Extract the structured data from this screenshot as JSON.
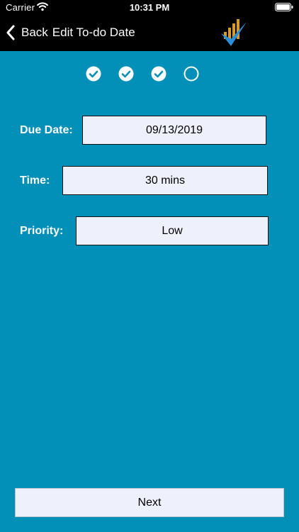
{
  "status_bar": {
    "carrier": "Carrier",
    "time": "10:31 PM"
  },
  "nav": {
    "back_label": "Back",
    "title": "Edit To-do Date",
    "logo_icon": "checkmark-bar-chart-logo"
  },
  "steps": [
    {
      "completed": true
    },
    {
      "completed": true
    },
    {
      "completed": true
    },
    {
      "completed": false
    }
  ],
  "form": {
    "due_date": {
      "label": "Due Date:",
      "value": "09/13/2019"
    },
    "time": {
      "label": "Time:",
      "value": "30 mins"
    },
    "priority": {
      "label": "Priority:",
      "value": "Low"
    }
  },
  "next_button": {
    "label": "Next"
  },
  "colors": {
    "background": "#0290B8",
    "header": "#000000",
    "field_bg": "#EEF1FB"
  }
}
